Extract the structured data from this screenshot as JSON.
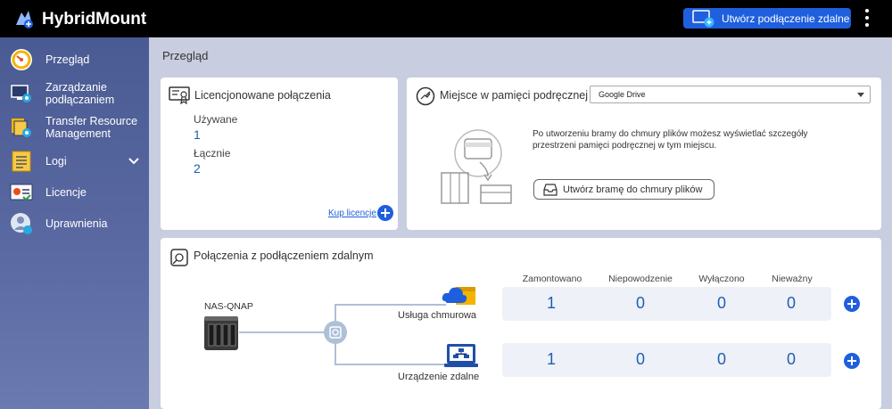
{
  "app": {
    "title": "HybridMount"
  },
  "header": {
    "remote_button_label": "Utwórz podłączenie zdalne"
  },
  "sidebar": {
    "items": [
      {
        "label": "Przegląd",
        "icon": "gauge-icon",
        "active": true
      },
      {
        "label": "Zarządzanie podłączaniem",
        "icon": "monitor-gear-icon"
      },
      {
        "label": "Transfer Resource Management",
        "icon": "transfer-gear-icon"
      },
      {
        "label": "Logi",
        "icon": "log-icon",
        "expandable": true
      },
      {
        "label": "Licencje",
        "icon": "license-icon"
      },
      {
        "label": "Uprawnienia",
        "icon": "user-lock-icon"
      }
    ]
  },
  "main": {
    "title": "Przegląd",
    "licensed": {
      "title": "Licencjonowane połączenia",
      "used_label": "Używane",
      "used_value": "1",
      "total_label": "Łącznie",
      "total_value": "2",
      "buy_link": "Kup licencje"
    },
    "cache": {
      "title": "Miejsce w pamięci podręcznej",
      "selected_option": "Google Drive",
      "description": "Po utworzeniu bramy do chmury plików możesz wyświetlać szczegóły przestrzeni pamięci podręcznej w tym miejscu.",
      "create_gateway_button": "Utwórz bramę do chmury plików"
    },
    "remote": {
      "title": "Połączenia z podłączeniem zdalnym",
      "nas_label": "NAS-QNAP",
      "columns": [
        "Zamontowano",
        "Niepowodzenie",
        "Wyłączono",
        "Nieważny"
      ],
      "rows": [
        {
          "label": "Usługa chmurowa",
          "values": [
            "1",
            "0",
            "0",
            "0"
          ]
        },
        {
          "label": "Urządzenie zdalne",
          "values": [
            "1",
            "0",
            "0",
            "0"
          ]
        }
      ]
    }
  },
  "colors": {
    "accent": "#1f5fde",
    "sidebar": "#4a5a92",
    "value_blue": "#1f5fb4"
  }
}
